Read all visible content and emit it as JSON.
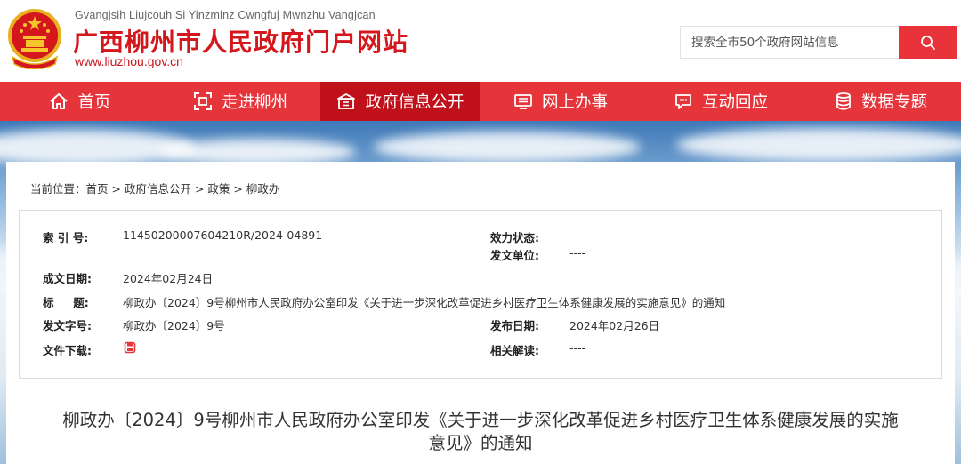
{
  "header": {
    "pinyin": "Gvangjsih Liujcouh Si Yinzminz Cwngfuj Mwnzhu Vangjcan",
    "title": "广西柳州市人民政府门户网站",
    "url": "www.liuzhou.gov.cn",
    "search_placeholder": "搜索全市50个政府网站信息"
  },
  "colors": {
    "brand_red": "#e6343b",
    "active_red": "#c01019",
    "title_red": "#d4171c"
  },
  "nav": [
    {
      "label": "首页",
      "icon": "home-icon"
    },
    {
      "label": "走进柳州",
      "icon": "scan-icon"
    },
    {
      "label": "政府信息公开",
      "icon": "building-icon",
      "active": true
    },
    {
      "label": "网上办事",
      "icon": "monitor-icon"
    },
    {
      "label": "互动回应",
      "icon": "chat-icon"
    },
    {
      "label": "数据专题",
      "icon": "database-icon"
    }
  ],
  "breadcrumb": {
    "prefix": "当前位置：",
    "items": [
      "首页",
      "政府信息公开",
      "政策",
      "柳政办"
    ],
    "sep": " > "
  },
  "info": {
    "index_label": "索 引 号:",
    "index_value": "11450200007604210R/2024-04891",
    "status_label": "效力状态:",
    "status_value": "",
    "unit_label": "发文单位:",
    "unit_value": "----",
    "date_label": "成文日期:",
    "date_value": "2024年02月24日",
    "title_label": "标     题:",
    "title_value": "柳政办〔2024〕9号柳州市人民政府办公室印发《关于进一步深化改革促进乡村医疗卫生体系健康发展的实施意见》的通知",
    "docno_label": "发文字号:",
    "docno_value": "柳政办〔2024〕9号",
    "pubdate_label": "发布日期:",
    "pubdate_value": "2024年02月26日",
    "download_label": "文件下载:",
    "related_label": "相关解读:",
    "related_value": "----"
  },
  "doc_title_line1": "柳政办〔2024〕9号柳州市人民政府办公室印发《关于进一步深化改革促进乡村医疗卫生体系健康发展的实施",
  "doc_title_line2": "意见》的通知"
}
